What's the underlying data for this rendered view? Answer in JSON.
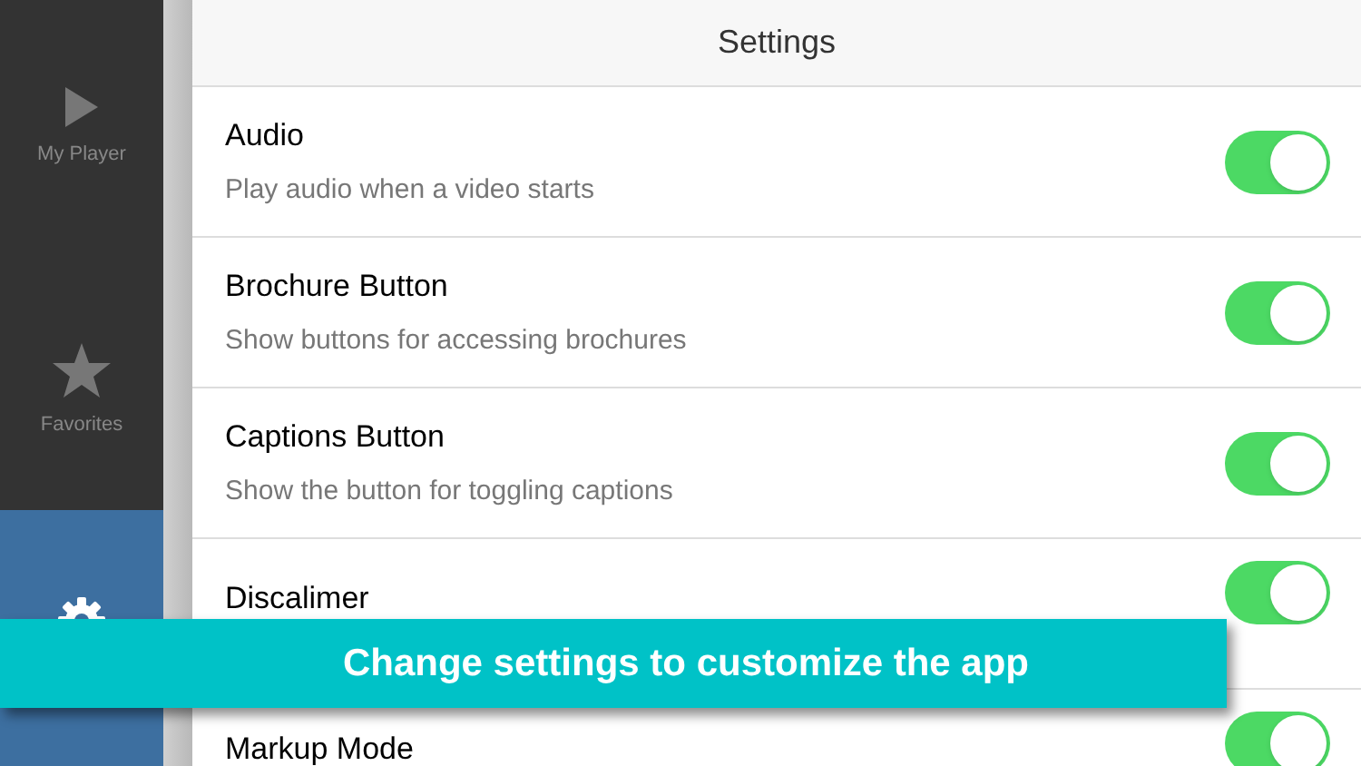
{
  "sidebar": {
    "tabs": [
      {
        "label": "My Player",
        "kind": "play",
        "selected": false
      },
      {
        "label": "Favorites",
        "kind": "star",
        "selected": false
      },
      {
        "kind": "gear",
        "selected": true
      }
    ]
  },
  "header": {
    "title": "Settings"
  },
  "settings": [
    {
      "title": "Audio",
      "subtitle": "Play audio when a video starts",
      "on": true
    },
    {
      "title": "Brochure Button",
      "subtitle": "Show buttons for accessing brochures",
      "on": true
    },
    {
      "title": "Captions Button",
      "subtitle": "Show the button for toggling captions",
      "on": true
    },
    {
      "title": "Discalimer",
      "on": true
    },
    {
      "title": "Markup Mode",
      "on": true
    }
  ],
  "banner": {
    "text": "Change settings to customize the app"
  }
}
